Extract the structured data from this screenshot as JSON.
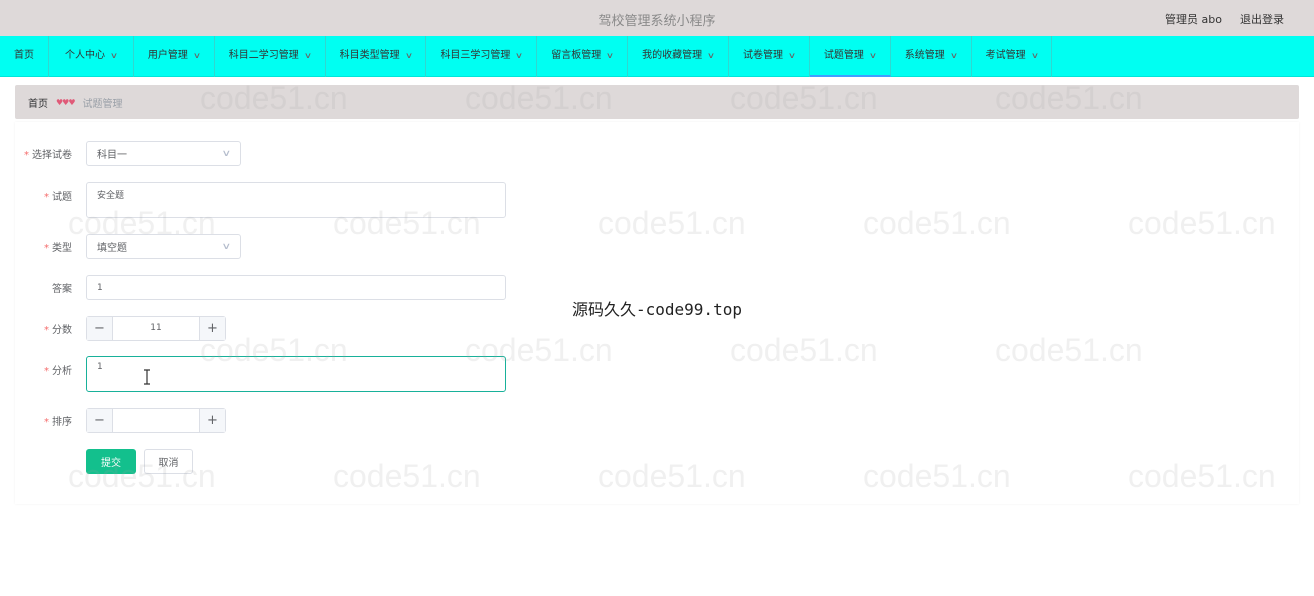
{
  "app": {
    "title": "驾校管理系统小程序"
  },
  "user": {
    "role_name": "管理员 abo",
    "logout": "退出登录"
  },
  "nav": [
    {
      "label": "首页",
      "dropdown": false
    },
    {
      "label": "个人中心",
      "dropdown": true
    },
    {
      "label": "用户管理",
      "dropdown": true
    },
    {
      "label": "科目二学习管理",
      "dropdown": true
    },
    {
      "label": "科目类型管理",
      "dropdown": true
    },
    {
      "label": "科目三学习管理",
      "dropdown": true
    },
    {
      "label": "留言板管理",
      "dropdown": true
    },
    {
      "label": "我的收藏管理",
      "dropdown": true
    },
    {
      "label": "试卷管理",
      "dropdown": true
    },
    {
      "label": "试题管理",
      "dropdown": true,
      "active": true
    },
    {
      "label": "系统管理",
      "dropdown": true
    },
    {
      "label": "考试管理",
      "dropdown": true
    }
  ],
  "breadcrumb": {
    "home": "首页",
    "current": "试题管理"
  },
  "form": {
    "paper": {
      "label": "选择试卷",
      "value": "科目一",
      "required": true
    },
    "question": {
      "label": "试题",
      "value": "安全题",
      "required": true
    },
    "type": {
      "label": "类型",
      "value": "填空题",
      "required": true
    },
    "answer": {
      "label": "答案",
      "value": "1",
      "required": false
    },
    "score": {
      "label": "分数",
      "value": "11",
      "required": true
    },
    "analysis": {
      "label": "分析",
      "value": "1",
      "required": true
    },
    "sort": {
      "label": "排序",
      "value": "",
      "required": true
    },
    "submit": "提交",
    "cancel": "取消"
  },
  "overlay": "源码久久-code99.top",
  "watermark": "code51.cn",
  "colors": {
    "topbar": "#ded9d9",
    "navbar": "#00fff2",
    "primary": "#13c08d",
    "required": "#f56c6c"
  }
}
